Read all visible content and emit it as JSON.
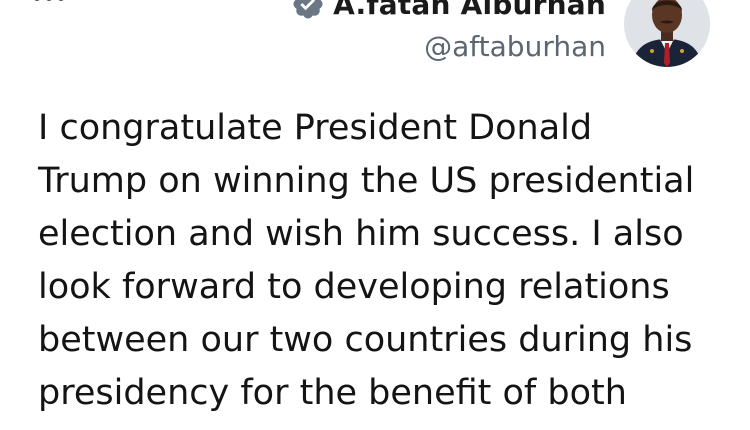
{
  "author": {
    "display_name": "A.fatah Alburhan",
    "handle": "@aftaburhan",
    "verified": true,
    "verified_color": "#6b7785"
  },
  "header": {
    "more_icon": "more-options-icon"
  },
  "tweet": {
    "lines": [
      "I congratulate President Donald",
      "Trump on winning the US presidential",
      "election and wish him success. I also",
      "look forward to developing relations",
      "between our two countries during his",
      "presidency for the benefit of both"
    ]
  }
}
